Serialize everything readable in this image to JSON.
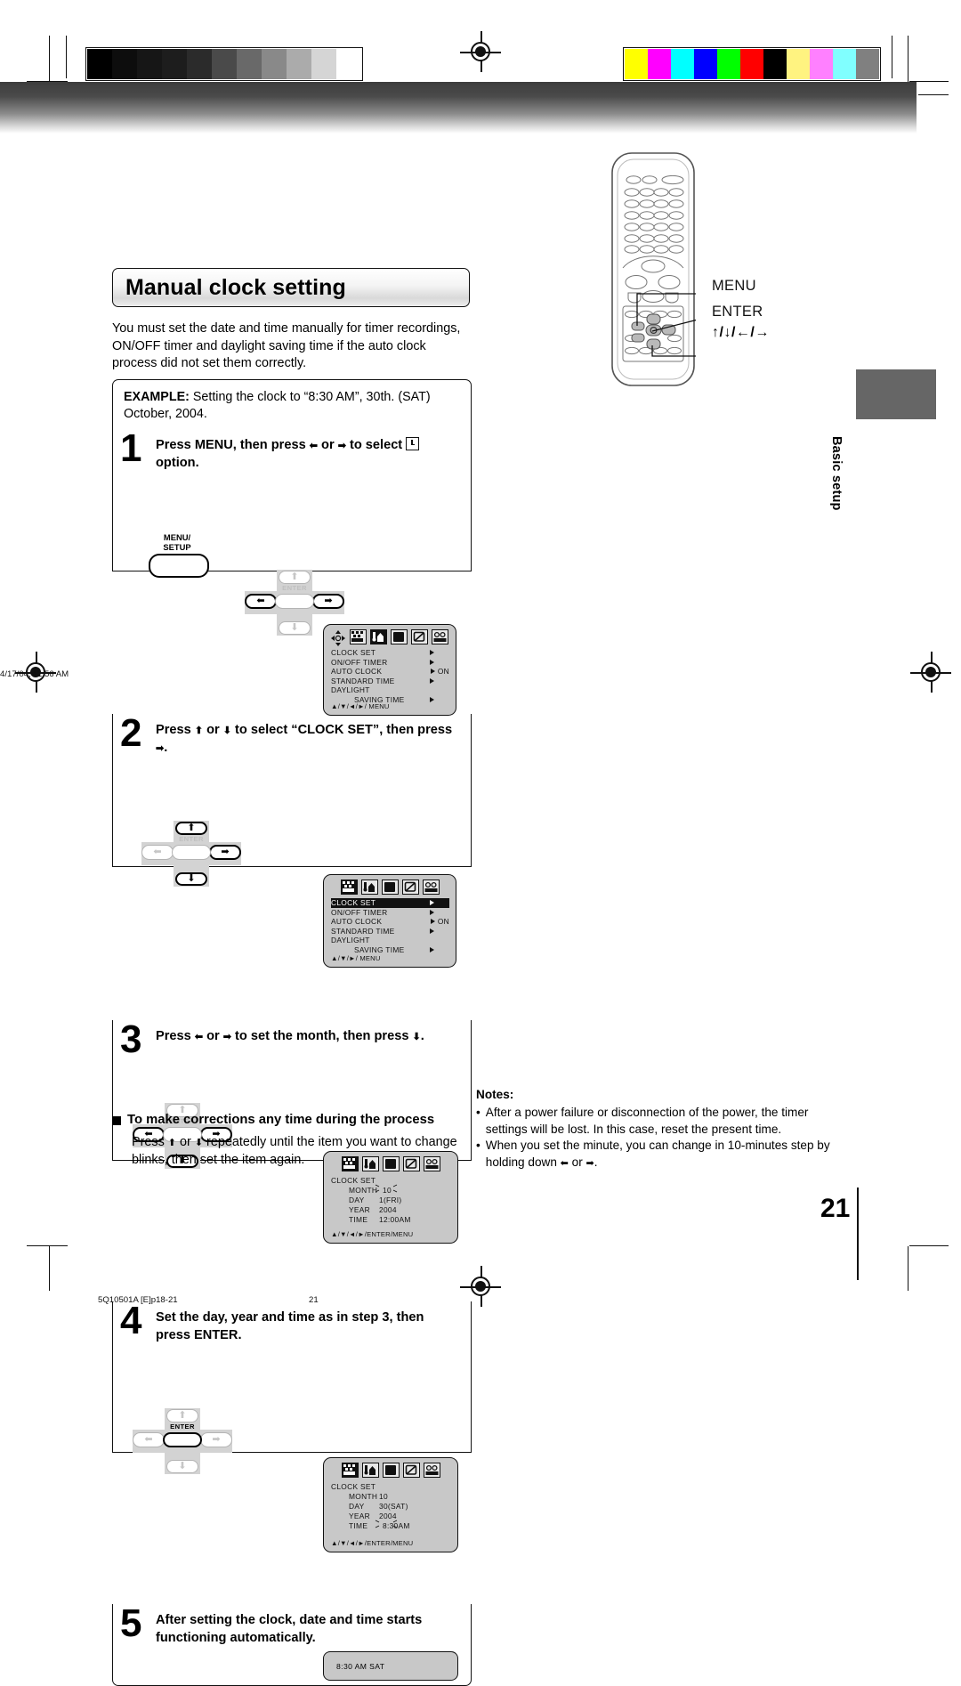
{
  "page": {
    "title": "Manual clock setting",
    "intro": "You must set the date and time manually for timer recordings, ON/OFF timer and daylight saving time if the auto clock process did not set them correctly.",
    "example_label": "EXAMPLE:",
    "example_text": "Setting the clock to “8:30 AM”, 30th. (SAT) October, 2004.",
    "side_tab_label": "Basic setup",
    "page_number": "21"
  },
  "remote": {
    "callouts": [
      {
        "name": "menu",
        "label": "MENU"
      },
      {
        "name": "enter",
        "label": "ENTER"
      },
      {
        "name": "arrows",
        "label": "↑/↓/←/→"
      }
    ]
  },
  "steps": [
    {
      "number": "1",
      "text_parts": [
        "Press MENU, then press ",
        " or ",
        " to select ",
        " option."
      ],
      "text": "Press MENU, then press ← or → to select ⌚ option.",
      "buttons": {
        "menu_label_line1": "MENU/",
        "menu_label_line2": "SETUP",
        "enter_label": "ENTER",
        "up": "off",
        "down": "off",
        "left": "on",
        "right": "on",
        "enter": "off"
      },
      "osd": {
        "kind": "menu",
        "show_cursor_pad": true,
        "selected_icon": 1,
        "rows": [
          {
            "label": "CLOCK  SET",
            "value": "",
            "arrow": true,
            "highlight": false
          },
          {
            "label": "ON/OFF  TIMER",
            "value": "",
            "arrow": true,
            "highlight": false
          },
          {
            "label": "AUTO  CLOCK",
            "value": "ON",
            "arrow": true,
            "highlight": false
          },
          {
            "label": "STANDARD  TIME",
            "value": "",
            "arrow": true,
            "highlight": false
          },
          {
            "label": "DAYLIGHT",
            "value": "",
            "arrow": false,
            "highlight": false
          },
          {
            "label": "SAVING  TIME",
            "value": "",
            "arrow": true,
            "highlight": false,
            "indent": true
          }
        ],
        "footer": "▲/▼/◄/►/ MENU"
      }
    },
    {
      "number": "2",
      "text": "Press ↑ or ↓ to select “CLOCK SET”, then press →.",
      "buttons": {
        "enter_label": "ENTER",
        "up": "on",
        "down": "on",
        "left": "off",
        "right": "on",
        "enter": "off"
      },
      "osd": {
        "kind": "menu",
        "show_cursor_pad": false,
        "selected_icon": 0,
        "rows": [
          {
            "label": "CLOCK  SET",
            "value": "",
            "arrow": true,
            "highlight": true
          },
          {
            "label": "ON/OFF  TIMER",
            "value": "",
            "arrow": true,
            "highlight": false
          },
          {
            "label": "AUTO  CLOCK",
            "value": "ON",
            "arrow": true,
            "highlight": false
          },
          {
            "label": "STANDARD  TIME",
            "value": "",
            "arrow": true,
            "highlight": false
          },
          {
            "label": "DAYLIGHT",
            "value": "",
            "arrow": false,
            "highlight": false
          },
          {
            "label": "SAVING  TIME",
            "value": "",
            "arrow": true,
            "highlight": false,
            "indent": true
          }
        ],
        "footer": "▲/▼/►/ MENU"
      }
    },
    {
      "number": "3",
      "text": "Press ← or → to set the month, then press ↓.",
      "buttons": {
        "enter_label": "ENTER",
        "up": "off",
        "down": "on",
        "left": "on",
        "right": "on",
        "enter": "off"
      },
      "osd": {
        "kind": "clockset",
        "selected_icon": 0,
        "header": "CLOCK  SET",
        "fields": [
          {
            "key": "MONTH",
            "value": "10",
            "blink": true
          },
          {
            "key": "DAY",
            "value": "1(FRI)",
            "blink": false
          },
          {
            "key": "YEAR",
            "value": "2004",
            "blink": false
          },
          {
            "key": "TIME",
            "value": "12:00AM",
            "blink": false
          }
        ],
        "footer": "▲/▼/◄/►/ENTER/MENU"
      }
    },
    {
      "number": "4",
      "text": "Set the day, year and time as in step 3, then press ENTER.",
      "buttons": {
        "enter_label": "ENTER",
        "up": "off",
        "down": "off",
        "left": "off",
        "right": "off",
        "enter": "on"
      },
      "osd": {
        "kind": "clockset",
        "selected_icon": 0,
        "header": "CLOCK  SET",
        "fields": [
          {
            "key": "MONTH",
            "value": "10",
            "blink": false
          },
          {
            "key": "DAY",
            "value": "30(SAT)",
            "blink": false
          },
          {
            "key": "YEAR",
            "value": "2004",
            "blink": false
          },
          {
            "key": "TIME",
            "value": "8:30AM",
            "blink": true
          }
        ],
        "footer": "▲/▼/◄/►/ENTER/MENU"
      }
    },
    {
      "number": "5",
      "text": "After setting the clock, date and time starts functioning automatically.",
      "lcd": "8:30 AM  SAT"
    }
  ],
  "corrections": {
    "heading": "To make corrections any time during the process",
    "body": "Press ↑ or ↓ repeatedly until the item you want to change blinks, then set the item again."
  },
  "notes": {
    "heading": "Notes:",
    "items": [
      "After a power failure or disconnection of the power, the timer settings will be lost. In this case, reset the present time.",
      "When you set the minute, you can change in 10-minutes step by holding down ← or →."
    ]
  },
  "footer": {
    "left": "5Q10501A [E]p18-21",
    "center": "21",
    "right": "4/17/04, 11:56 AM"
  },
  "colors": {
    "grayscale_bar": [
      "#000000",
      "#0d0d0d",
      "#161616",
      "#1d1d1d",
      "#2b2b2b",
      "#4a4a4a",
      "#696969",
      "#898989",
      "#ababab",
      "#d5d5d5",
      "#ffffff"
    ],
    "color_bar": [
      "#ffff00",
      "#ff00ff",
      "#00ffff",
      "#0000ff",
      "#00ff00",
      "#ff0000",
      "#000000",
      "#fff380",
      "#ff80ff",
      "#80ffff",
      "#808080"
    ],
    "osd_bg": "#c8c8c8",
    "tab_gray": "#666666"
  }
}
